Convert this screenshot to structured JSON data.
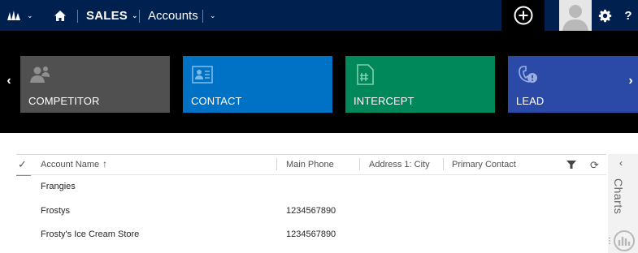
{
  "topbar": {
    "area_label": "SALES",
    "entity_label": "Accounts",
    "help_label": "?",
    "background": "#002050"
  },
  "tiles": [
    {
      "label": "COMPETITOR",
      "color": "#505050",
      "icon": "competitor-icon"
    },
    {
      "label": "CONTACT",
      "color": "#0072c6",
      "icon": "contact-icon"
    },
    {
      "label": "INTERCEPT",
      "color": "#00875a",
      "icon": "intercept-icon"
    },
    {
      "label": "LEAD",
      "color": "#2b4aa8",
      "icon": "lead-icon"
    }
  ],
  "grid": {
    "columns": [
      "Account Name",
      "Main Phone",
      "Address 1: City",
      "Primary Contact"
    ],
    "sort_indicator": "↑",
    "rows": [
      {
        "name": "Frangies",
        "phone": "",
        "city": "",
        "contact": ""
      },
      {
        "name": "Frostys",
        "phone": "1234567890",
        "city": "",
        "contact": ""
      },
      {
        "name": "Frosty's Ice Cream Store",
        "phone": "1234567890",
        "city": "",
        "contact": ""
      }
    ]
  },
  "charts_pane": {
    "label": "Charts"
  }
}
